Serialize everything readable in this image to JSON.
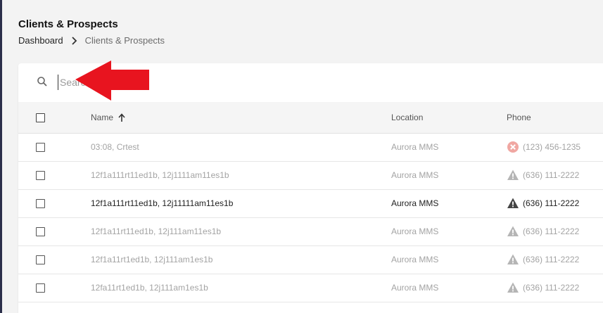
{
  "header": {
    "title": "Clients & Prospects"
  },
  "breadcrumb": {
    "home": "Dashboard",
    "current": "Clients & Prospects"
  },
  "search": {
    "placeholder": "Search"
  },
  "table": {
    "columns": {
      "name": "Name",
      "location": "Location",
      "phone": "Phone"
    },
    "sort": {
      "column": "Name",
      "direction": "ascending"
    },
    "rows": [
      {
        "name": "03:08, Crtest",
        "location": "Aurora MMS",
        "phone": "(123) 456-1235",
        "status_icon": "error-x-icon",
        "emphasis": "muted"
      },
      {
        "name": "12f1a111rt11ed1b, 12j1111am11es1b",
        "location": "Aurora MMS",
        "phone": "(636) 111-2222",
        "status_icon": "warning-icon",
        "emphasis": "muted"
      },
      {
        "name": "12f1a111rt11ed1b, 12j11111am11es1b",
        "location": "Aurora MMS",
        "phone": "(636) 111-2222",
        "status_icon": "warning-icon",
        "emphasis": "dark"
      },
      {
        "name": "12f1a11rt11ed1b, 12j111am11es1b",
        "location": "Aurora MMS",
        "phone": "(636) 111-2222",
        "status_icon": "warning-icon",
        "emphasis": "muted"
      },
      {
        "name": "12f1a11rt1ed1b, 12j111am1es1b",
        "location": "Aurora MMS",
        "phone": "(636) 111-2222",
        "status_icon": "warning-icon",
        "emphasis": "muted"
      },
      {
        "name": "12fa11rt1ed1b, 12j111am1es1b",
        "location": "Aurora MMS",
        "phone": "(636) 111-2222",
        "status_icon": "warning-icon",
        "emphasis": "muted"
      }
    ]
  },
  "colors": {
    "annotation_arrow": "#e8141f",
    "error_icon": "#f0a7a2",
    "warning_icon_muted": "#b5b5b5",
    "warning_icon_dark": "#444444"
  }
}
